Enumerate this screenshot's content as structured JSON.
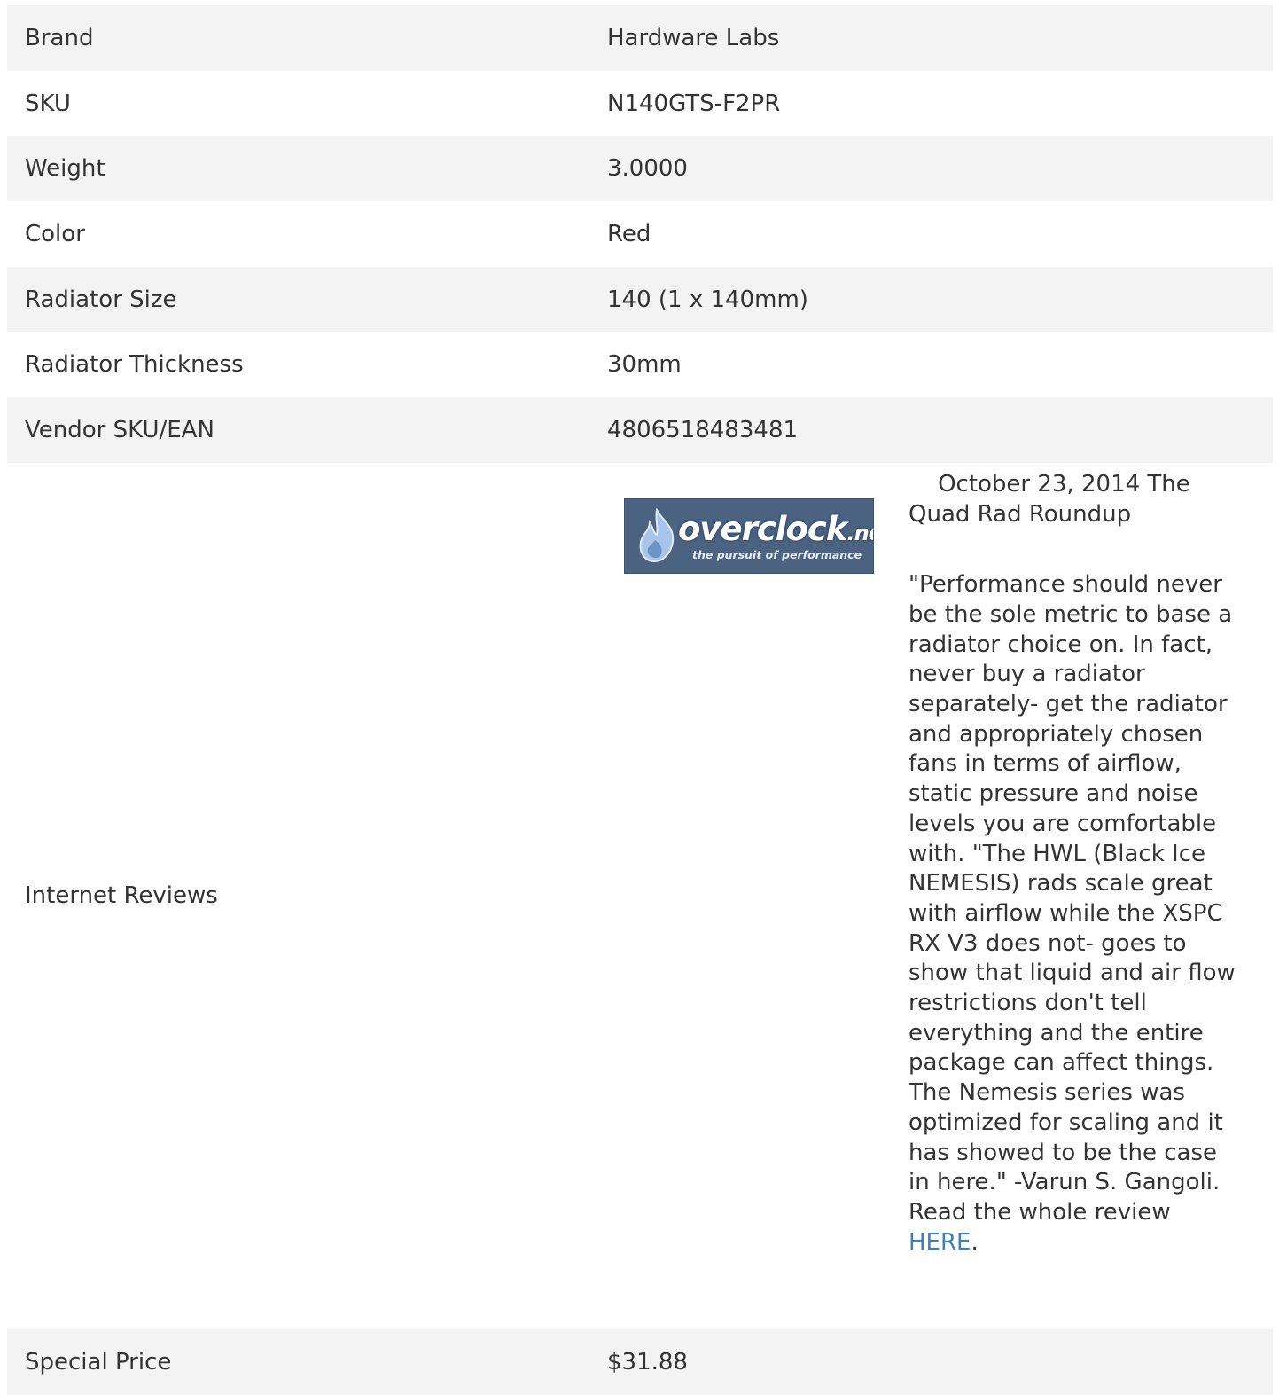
{
  "specs": [
    {
      "label": "Brand",
      "value": "Hardware Labs"
    },
    {
      "label": "SKU",
      "value": "N140GTS-F2PR"
    },
    {
      "label": "Weight",
      "value": "3.0000"
    },
    {
      "label": "Color",
      "value": "Red"
    },
    {
      "label": "Radiator Size",
      "value": "140 (1 x 140mm)"
    },
    {
      "label": "Radiator Thickness",
      "value": "30mm"
    },
    {
      "label": "Vendor SKU/EAN",
      "value": "4806518483481"
    }
  ],
  "reviews": {
    "label": "Internet Reviews",
    "logo": {
      "main": "overclock",
      "tld": ".net",
      "tagline": "the pursuit of performance"
    },
    "heading": "October 23, 2014   The Quad Rad Roundup",
    "quote": "\"Performance should never be the sole metric to base a radiator choice on. In fact, never buy a radiator separately- get the radiator and appropriately chosen fans in terms of airflow, static pressure and noise levels you are comfortable with. \"The HWL (Black Ice NEMESIS) rads scale great with airflow while the XSPC RX V3 does not- goes to show that liquid and air flow restrictions don't tell everything and the entire package can affect things. The Nemesis series was optimized for scaling and it has showed to be the case in here.\"  -Varun S. Gangoli. Read the whole review ",
    "link_text": "HERE",
    "trailing": "."
  },
  "price": {
    "label": "Special Price",
    "value": "$31.88"
  }
}
